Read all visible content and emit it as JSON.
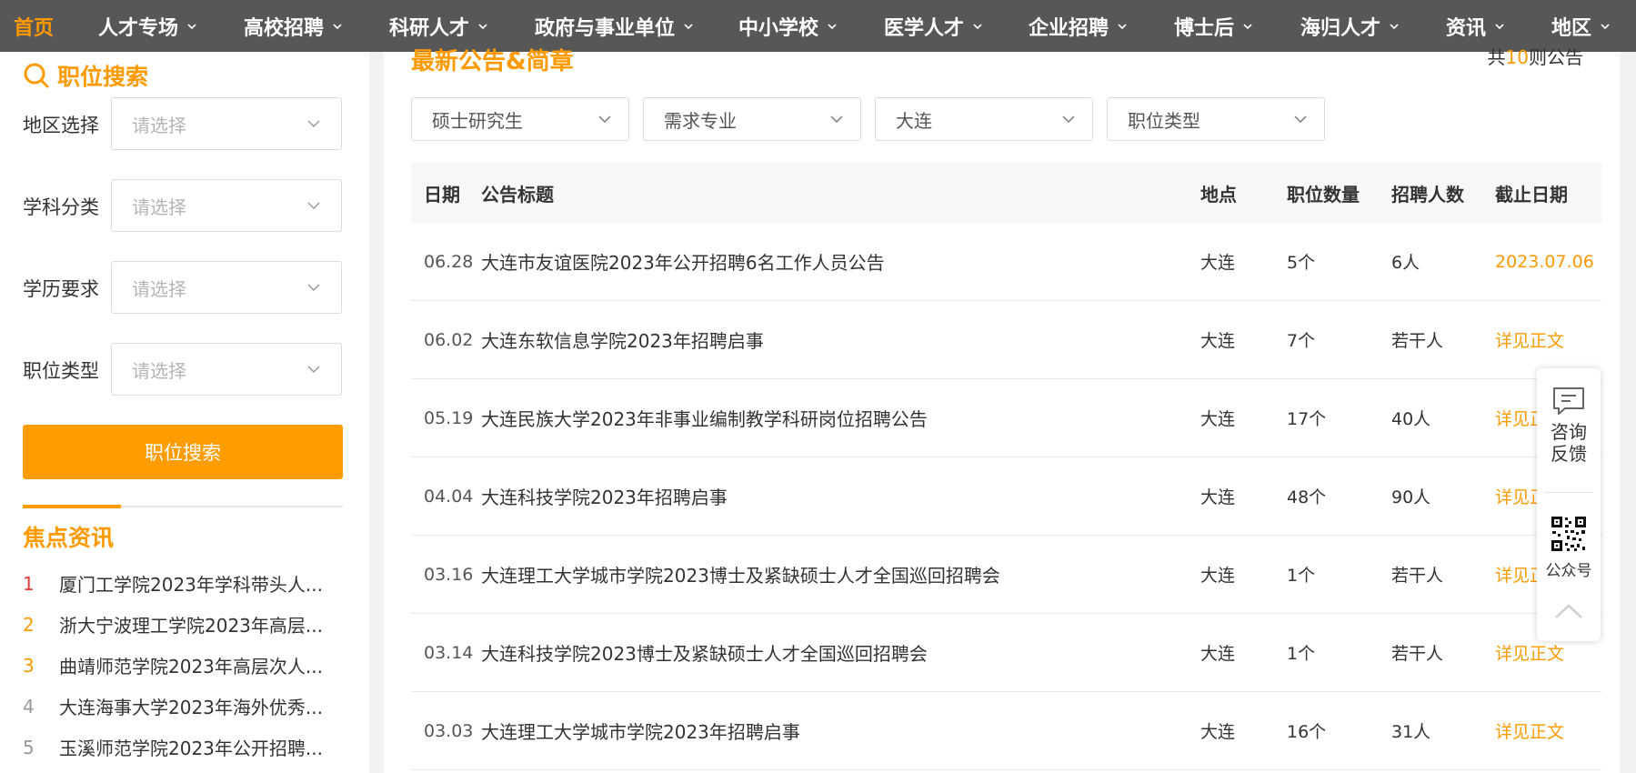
{
  "nav": {
    "items": [
      {
        "label": "首页",
        "active": true,
        "dropdown": false
      },
      {
        "label": "人才专场",
        "dropdown": true
      },
      {
        "label": "高校招聘",
        "dropdown": true
      },
      {
        "label": "科研人才",
        "dropdown": true
      },
      {
        "label": "政府与事业单位",
        "dropdown": true
      },
      {
        "label": "中小学校",
        "dropdown": true
      },
      {
        "label": "医学人才",
        "dropdown": true
      },
      {
        "label": "企业招聘",
        "dropdown": true
      },
      {
        "label": "博士后",
        "dropdown": true
      },
      {
        "label": "海归人才",
        "dropdown": true
      },
      {
        "label": "资讯",
        "dropdown": true
      },
      {
        "label": "地区",
        "dropdown": true
      }
    ]
  },
  "sidebar": {
    "title": "职位搜索",
    "title_icon": "search-icon",
    "filters": [
      {
        "label": "地区选择",
        "placeholder": "请选择"
      },
      {
        "label": "学科分类",
        "placeholder": "请选择"
      },
      {
        "label": "学历要求",
        "placeholder": "请选择"
      },
      {
        "label": "职位类型",
        "placeholder": "请选择"
      }
    ],
    "search_button": "职位搜索",
    "focus_title": "焦点资讯",
    "news": [
      {
        "rank": "1",
        "text": "厦门工学院2023年学科带头人...",
        "color": "#e53935"
      },
      {
        "rank": "2",
        "text": "浙大宁波理工学院2023年高层...",
        "color": "#ff9a00"
      },
      {
        "rank": "3",
        "text": "曲靖师范学院2023年高层次人...",
        "color": "#ff9a00"
      },
      {
        "rank": "4",
        "text": "大连海事大学2023年海外优秀...",
        "color": "#999999"
      },
      {
        "rank": "5",
        "text": "玉溪师范学院2023年公开招聘...",
        "color": "#999999"
      }
    ]
  },
  "main": {
    "title": "最新公告&简章",
    "total_prefix": "共",
    "total_count": "10",
    "total_suffix": "则公告",
    "filters": [
      "硕士研究生",
      "需求专业",
      "大连",
      "职位类型"
    ],
    "columns": {
      "date": "日期",
      "title": "公告标题",
      "location": "地点",
      "positions": "职位数量",
      "hires": "招聘人数",
      "deadline": "截止日期"
    },
    "rows": [
      {
        "date": "06.28",
        "title": "大连市友谊医院2023年公开招聘6名工作人员公告",
        "location": "大连",
        "positions": "5个",
        "hires": "6人",
        "deadline": "2023.07.06"
      },
      {
        "date": "06.02",
        "title": "大连东软信息学院2023年招聘启事",
        "location": "大连",
        "positions": "7个",
        "hires": "若干人",
        "deadline": "详见正文"
      },
      {
        "date": "05.19",
        "title": "大连民族大学2023年非事业编制教学科研岗位招聘公告",
        "location": "大连",
        "positions": "17个",
        "hires": "40人",
        "deadline": "详见正"
      },
      {
        "date": "04.04",
        "title": "大连科技学院2023年招聘启事",
        "location": "大连",
        "positions": "48个",
        "hires": "90人",
        "deadline": "详见正"
      },
      {
        "date": "03.16",
        "title": "大连理工大学城市学院2023博士及紧缺硕士人才全国巡回招聘会",
        "location": "大连",
        "positions": "1个",
        "hires": "若干人",
        "deadline": "详见正"
      },
      {
        "date": "03.14",
        "title": "大连科技学院2023博士及紧缺硕士人才全国巡回招聘会",
        "location": "大连",
        "positions": "1个",
        "hires": "若干人",
        "deadline": "详见正文"
      },
      {
        "date": "03.03",
        "title": "大连理工大学城市学院2023年招聘启事",
        "location": "大连",
        "positions": "16个",
        "hires": "31人",
        "deadline": "详见正文"
      }
    ]
  },
  "float_widget": {
    "feedback_line1": "咨询",
    "feedback_line2": "反馈",
    "qr_label": "公众号"
  },
  "colors": {
    "accent": "#ff9a00",
    "nav_bg": "#575757",
    "rank_first": "#e53935"
  }
}
